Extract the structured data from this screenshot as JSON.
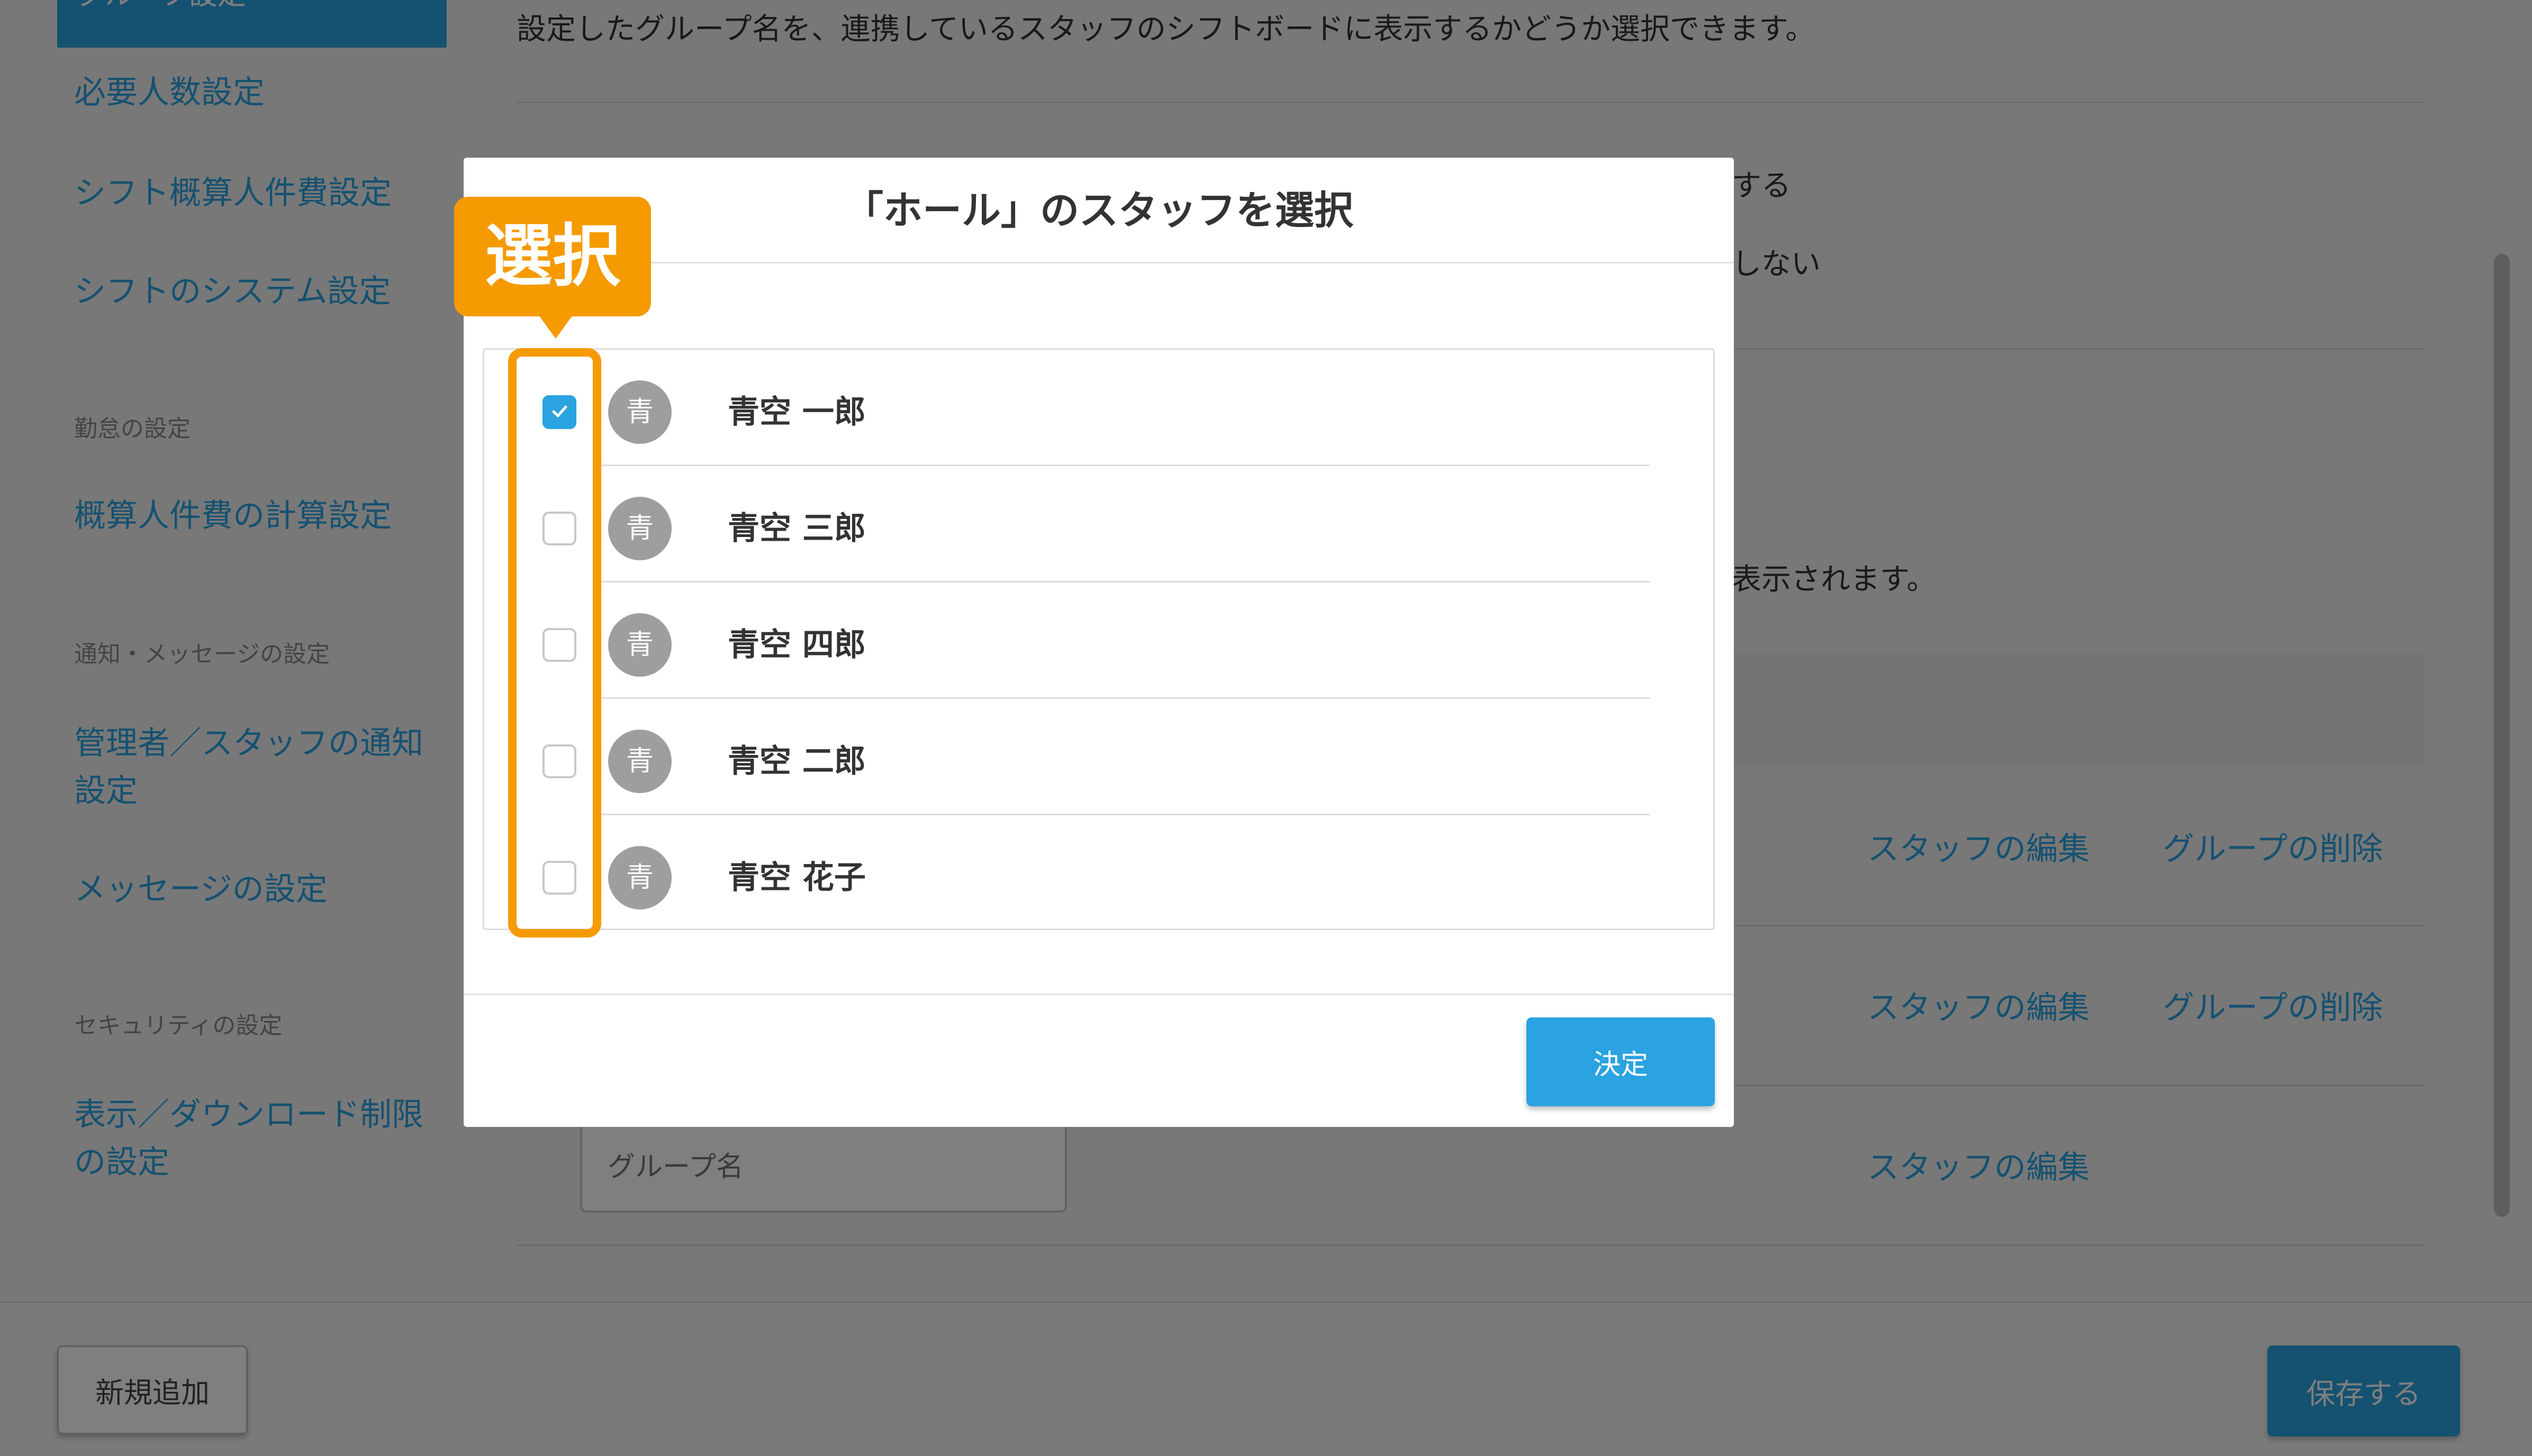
{
  "sidebar": {
    "active_item": "グループ設定",
    "items": [
      {
        "label": "必要人数設定"
      },
      {
        "label": "シフト概算人件費設定"
      },
      {
        "label": "シフトのシステム設定"
      },
      {
        "label": "概算人件費の計算設定"
      },
      {
        "label": "管理者／スタッフの通知設定"
      },
      {
        "label": "メッセージの設定"
      },
      {
        "label": "表示／ダウンロード制限の設定"
      }
    ],
    "sections": [
      "勤怠の設定",
      "通知・メッセージの設定",
      "セキュリティの設定"
    ]
  },
  "main": {
    "description_1": "設定したグループ名を、連携しているスタッフのシフトボードに表示するかどうか選択できます。",
    "option_show_partial": "する",
    "option_hide_partial": "しない",
    "description_2_partial": "表示されます。",
    "group_input_placeholder": "グループ名",
    "rows": [
      {
        "edit_staff": "スタッフの編集",
        "delete_group": "グループの削除"
      },
      {
        "edit_staff": "スタッフの編集",
        "delete_group": "グループの削除"
      },
      {
        "edit_staff": "スタッフの編集",
        "delete_group": ""
      }
    ]
  },
  "footer": {
    "add_new": "新規追加",
    "save": "保存する"
  },
  "modal": {
    "close_glyph": "×",
    "title": "「ホール」のスタッフを選択",
    "staff": [
      {
        "avatar": "青",
        "name": "青空 一郎",
        "checked": true
      },
      {
        "avatar": "青",
        "name": "青空 三郎",
        "checked": false
      },
      {
        "avatar": "青",
        "name": "青空 四郎",
        "checked": false
      },
      {
        "avatar": "青",
        "name": "青空 二郎",
        "checked": false
      },
      {
        "avatar": "青",
        "name": "青空 花子",
        "checked": false
      }
    ],
    "confirm": "決定"
  },
  "annotation": {
    "label": "選択",
    "color": "#f59a00"
  },
  "colors": {
    "accent": "#2aa3e0",
    "annotation": "#f59a00"
  }
}
